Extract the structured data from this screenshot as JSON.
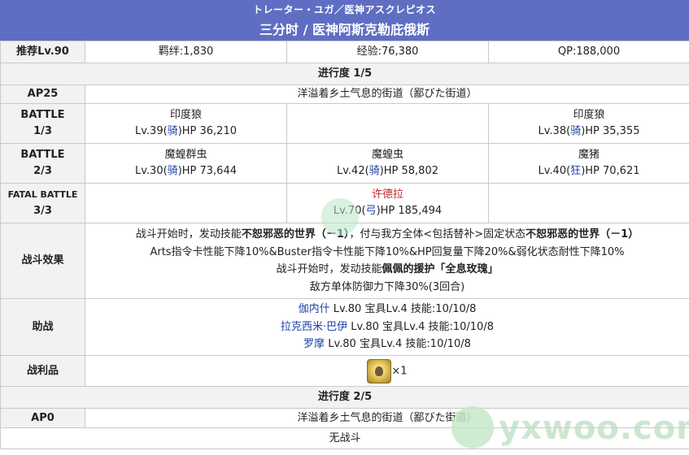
{
  "header": {
    "jp_title": "トレーター・ユガ／医神アスクレピオス",
    "cn_title": "三分时 / 医神阿斯克勒庇俄斯"
  },
  "info": {
    "level_label": "推荐Lv.90",
    "bond": "羁绊:1,830",
    "exp": "经验:76,380",
    "qp": "QP:188,000"
  },
  "progress1": {
    "title": "进行度 1/5",
    "ap": "AP25",
    "location": "洋溢着乡土气息的街道（鄙びた街道）",
    "battles": [
      {
        "label_top": "BATTLE",
        "label_bottom": "1/3",
        "enemies": [
          {
            "name": "印度狼",
            "lv": "Lv.39(",
            "cls": "骑",
            "hp": ")HP 36,210"
          },
          {
            "name": "",
            "lv": "",
            "cls": "",
            "hp": ""
          },
          {
            "name": "印度狼",
            "lv": "Lv.38(",
            "cls": "骑",
            "hp": ")HP 35,355"
          }
        ]
      },
      {
        "label_top": "BATTLE",
        "label_bottom": "2/3",
        "enemies": [
          {
            "name": "魔蝗群虫",
            "lv": "Lv.30(",
            "cls": "骑",
            "hp": ")HP 73,644"
          },
          {
            "name": "魔蝗虫",
            "lv": "Lv.42(",
            "cls": "骑",
            "hp": ")HP 58,802"
          },
          {
            "name": "魔猪",
            "lv": "Lv.40(",
            "cls": "狂",
            "hp": ")HP 70,621"
          }
        ]
      },
      {
        "label_top": "FATAL BATTLE",
        "label_bottom": "3/3",
        "enemies": [
          {
            "name": "",
            "lv": "",
            "cls": "",
            "hp": ""
          },
          {
            "name": "许德拉",
            "lv": "Lv.70(",
            "cls": "弓",
            "hp": ")HP 185,494"
          },
          {
            "name": "",
            "lv": "",
            "cls": "",
            "hp": ""
          }
        ]
      }
    ],
    "effects_label": "战斗效果",
    "effects": {
      "l1a": "战斗开始时，发动技能",
      "l1b": "不恕邪恶的世界（－1）",
      "l1c": "，付与我方全体<包括替补>固定状态",
      "l1d": "不恕邪恶的世界（－1）",
      "l2": "Arts指令卡性能下降10%&Buster指令卡性能下降10%&HP回复量下降20%&弱化状态耐性下降10%",
      "l3a": "战斗开始时，发动技能",
      "l3b": "佩佩的援护「全息玫瑰」",
      "l4": "敌方单体防御力下降30%(3回合)"
    },
    "support_label": "助战",
    "supports": [
      {
        "name": "伽内什",
        "detail": " Lv.80 宝具Lv.4 技能:10/10/8"
      },
      {
        "name": "拉克西米·巴伊",
        "detail": " Lv.80 宝具Lv.4 技能:10/10/8"
      },
      {
        "name": "罗摩",
        "detail": " Lv.80 宝具Lv.4 技能:10/10/8"
      }
    ],
    "drops_label": "战利品",
    "drop_icon": "treasure-item-icon",
    "drop_count": "×1"
  },
  "progress2": {
    "title": "进行度 2/5",
    "ap": "AP0",
    "location": "洋溢着乡土气息的街道（鄙びた街道）",
    "no_battle": "无战斗"
  },
  "watermark": {
    "text": "yxwoo.com"
  },
  "colors": {
    "header_bg": "#5f6ec2",
    "label_bg": "#f2f2f2",
    "servant_link": "#1a3fa8",
    "boss_name": "#c0262b"
  }
}
